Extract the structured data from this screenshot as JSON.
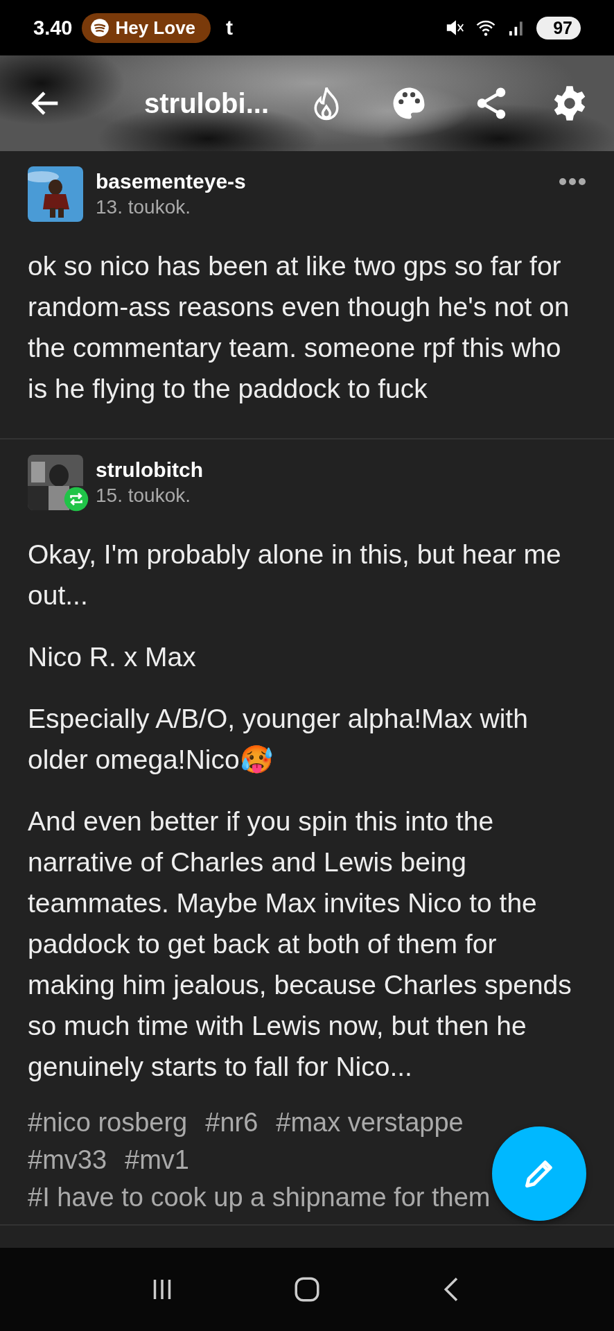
{
  "status_bar": {
    "time": "3.40",
    "media_chip": "Hey Love",
    "app_letter": "t",
    "battery": "97"
  },
  "header": {
    "title": "strulobi..."
  },
  "posts": [
    {
      "author": "basementeye-s",
      "date": "13. toukok.",
      "reblog": false,
      "menu": true,
      "paragraphs": [
        "ok so nico has been at like two gps so far for random-ass reasons even though he's not on the commentary team. someone rpf this who is he flying to the paddock to fuck"
      ]
    },
    {
      "author": "strulobitch",
      "date": "15. toukok.",
      "reblog": true,
      "menu": false,
      "paragraphs": [
        "Okay, I'm probably alone in this, but hear me out...",
        "Nico R. x Max",
        "Especially A/B/O, younger alpha!Max with older omega!Nico🥵",
        "And even better if you spin this into the narrative of Charles and Lewis being teammates. Maybe Max invites Nico to the paddock to get back at both of them for making him jealous, because Charles spends so much time with Lewis now, but then he genuinely starts to fall for Nico..."
      ],
      "tag_lines": [
        [
          "#nico rosberg",
          "#nr6",
          "#max verstappe"
        ],
        [
          "#mv33",
          "#mv1"
        ],
        [
          "#I have to cook up a shipname for them"
        ]
      ]
    }
  ]
}
